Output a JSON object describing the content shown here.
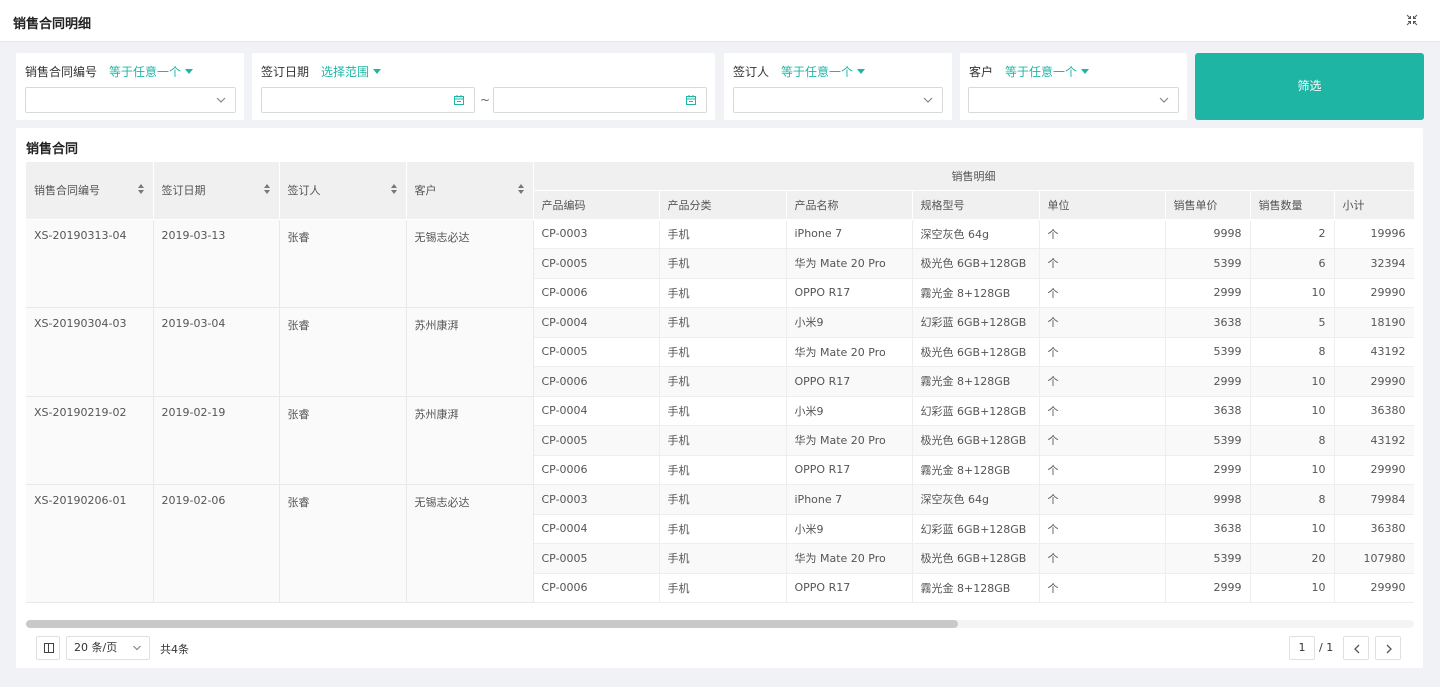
{
  "window": {
    "title": "销售合同明细"
  },
  "filters": [
    {
      "label": "销售合同编号",
      "operator": "等于任意一个",
      "value": ""
    },
    {
      "label": "签订日期",
      "operator": "选择范围",
      "start": "",
      "end": "",
      "separator": "~"
    },
    {
      "label": "签订人",
      "operator": "等于任意一个",
      "value": ""
    },
    {
      "label": "客户",
      "operator": "等于任意一个",
      "value": ""
    }
  ],
  "filter_button": "筛选",
  "card": {
    "title": "销售合同"
  },
  "table": {
    "headers": {
      "contract_no": "销售合同编号",
      "date": "签订日期",
      "signer": "签订人",
      "customer": "客户",
      "detail_group": "销售明细",
      "product_code": "产品编码",
      "category": "产品分类",
      "product_name": "产品名称",
      "spec": "规格型号",
      "unit": "单位",
      "price": "销售单价",
      "qty": "销售数量",
      "subtotal": "小计"
    },
    "contracts": [
      {
        "no": "XS-20190313-04",
        "date": "2019-03-13",
        "signer": "张睿",
        "customer": "无锡志必达",
        "items": [
          {
            "code": "CP-0003",
            "category": "手机",
            "name": "iPhone 7",
            "spec": "深空灰色 64g",
            "unit": "个",
            "price": "9998",
            "qty": "2",
            "subtotal": "19996"
          },
          {
            "code": "CP-0005",
            "category": "手机",
            "name": "华为 Mate 20 Pro",
            "spec": "极光色 6GB+128GB",
            "unit": "个",
            "price": "5399",
            "qty": "6",
            "subtotal": "32394"
          },
          {
            "code": "CP-0006",
            "category": "手机",
            "name": "OPPO R17",
            "spec": "霧光金 8+128GB",
            "unit": "个",
            "price": "2999",
            "qty": "10",
            "subtotal": "29990"
          }
        ]
      },
      {
        "no": "XS-20190304-03",
        "date": "2019-03-04",
        "signer": "张睿",
        "customer": "苏州康湃",
        "items": [
          {
            "code": "CP-0004",
            "category": "手机",
            "name": "小米9",
            "spec": "幻彩蓝 6GB+128GB",
            "unit": "个",
            "price": "3638",
            "qty": "5",
            "subtotal": "18190"
          },
          {
            "code": "CP-0005",
            "category": "手机",
            "name": "华为 Mate 20 Pro",
            "spec": "极光色 6GB+128GB",
            "unit": "个",
            "price": "5399",
            "qty": "8",
            "subtotal": "43192"
          },
          {
            "code": "CP-0006",
            "category": "手机",
            "name": "OPPO R17",
            "spec": "霧光金 8+128GB",
            "unit": "个",
            "price": "2999",
            "qty": "10",
            "subtotal": "29990"
          }
        ]
      },
      {
        "no": "XS-20190219-02",
        "date": "2019-02-19",
        "signer": "张睿",
        "customer": "苏州康湃",
        "items": [
          {
            "code": "CP-0004",
            "category": "手机",
            "name": "小米9",
            "spec": "幻彩蓝 6GB+128GB",
            "unit": "个",
            "price": "3638",
            "qty": "10",
            "subtotal": "36380"
          },
          {
            "code": "CP-0005",
            "category": "手机",
            "name": "华为 Mate 20 Pro",
            "spec": "极光色 6GB+128GB",
            "unit": "个",
            "price": "5399",
            "qty": "8",
            "subtotal": "43192"
          },
          {
            "code": "CP-0006",
            "category": "手机",
            "name": "OPPO R17",
            "spec": "霧光金 8+128GB",
            "unit": "个",
            "price": "2999",
            "qty": "10",
            "subtotal": "29990"
          }
        ]
      },
      {
        "no": "XS-20190206-01",
        "date": "2019-02-06",
        "signer": "张睿",
        "customer": "无锡志必达",
        "items": [
          {
            "code": "CP-0003",
            "category": "手机",
            "name": "iPhone 7",
            "spec": "深空灰色 64g",
            "unit": "个",
            "price": "9998",
            "qty": "8",
            "subtotal": "79984"
          },
          {
            "code": "CP-0004",
            "category": "手机",
            "name": "小米9",
            "spec": "幻彩蓝 6GB+128GB",
            "unit": "个",
            "price": "3638",
            "qty": "10",
            "subtotal": "36380"
          },
          {
            "code": "CP-0005",
            "category": "手机",
            "name": "华为 Mate 20 Pro",
            "spec": "极光色 6GB+128GB",
            "unit": "个",
            "price": "5399",
            "qty": "20",
            "subtotal": "107980"
          },
          {
            "code": "CP-0006",
            "category": "手机",
            "name": "OPPO R17",
            "spec": "霧光金 8+128GB",
            "unit": "个",
            "price": "2999",
            "qty": "10",
            "subtotal": "29990"
          }
        ]
      }
    ]
  },
  "pagination": {
    "page_size": "20 条/页",
    "total": "共4条",
    "current": "1",
    "of_total": "/ 1"
  },
  "icons": {
    "collapse": "collapse-icon",
    "chevron": "chevron-down-icon",
    "calendar": "calendar-icon",
    "sort": "sort-icon",
    "columns": "column-settings-icon",
    "prev": "chevron-left-icon",
    "next": "chevron-right-icon"
  },
  "colors": {
    "accent": "#1fb5a5"
  }
}
